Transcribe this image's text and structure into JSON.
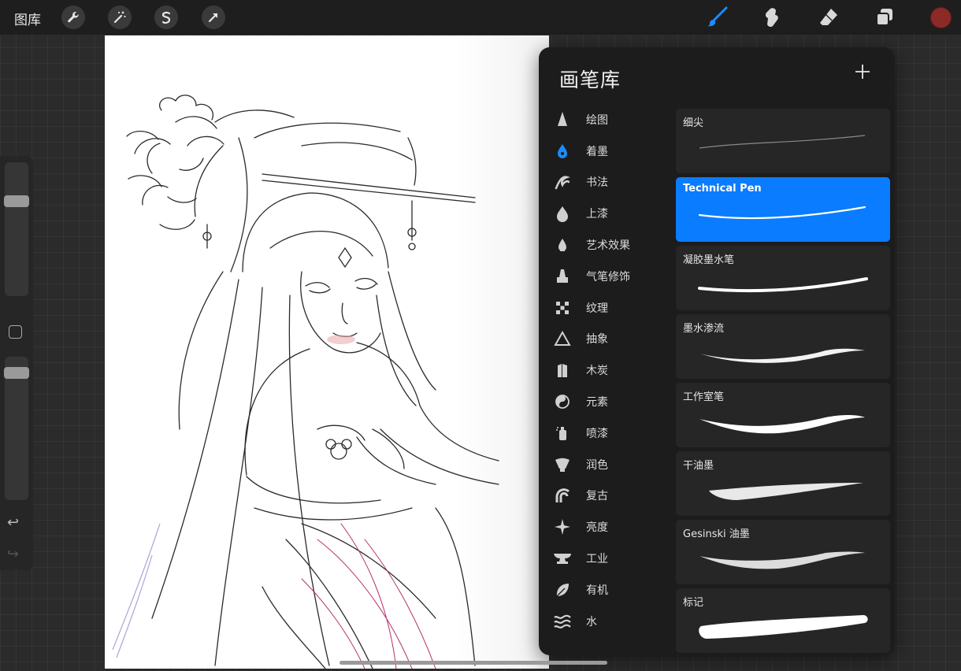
{
  "topbar": {
    "gallery_label": "图库",
    "left_tools": [
      "wrench-icon",
      "magic-wand-icon",
      "selection-icon",
      "transform-arrow-icon"
    ],
    "right_tools": [
      "brush-icon",
      "smudge-icon",
      "eraser-icon",
      "layers-icon"
    ],
    "active_tool": "brush",
    "accent_color": "#1a8cff",
    "current_color": "#8c2a28"
  },
  "sidebar": {
    "size_slider_level": 0.73,
    "opacity_slider_level": 0.92,
    "icons": [
      "modify-square-icon",
      "undo-icon",
      "redo-icon"
    ]
  },
  "brush_library": {
    "title": "画笔库",
    "add_icon": "plus-icon",
    "sets": [
      {
        "label": "绘图",
        "icon": "pencil-tip-icon"
      },
      {
        "label": "着墨",
        "icon": "ink-pen-icon",
        "active": true
      },
      {
        "label": "书法",
        "icon": "calligraphy-icon"
      },
      {
        "label": "上漆",
        "icon": "paint-drop-icon"
      },
      {
        "label": "艺术效果",
        "icon": "artistic-drop-icon"
      },
      {
        "label": "气笔修饰",
        "icon": "airbrush-icon"
      },
      {
        "label": "纹理",
        "icon": "texture-checker-icon"
      },
      {
        "label": "抽象",
        "icon": "triangle-icon"
      },
      {
        "label": "木炭",
        "icon": "charcoal-icon"
      },
      {
        "label": "元素",
        "icon": "yin-yang-icon"
      },
      {
        "label": "喷漆",
        "icon": "spray-can-icon"
      },
      {
        "label": "润色",
        "icon": "fan-brush-icon"
      },
      {
        "label": "复古",
        "icon": "vintage-arch-icon"
      },
      {
        "label": "亮度",
        "icon": "sparkle-icon"
      },
      {
        "label": "工业",
        "icon": "anvil-icon"
      },
      {
        "label": "有机",
        "icon": "leaf-icon"
      },
      {
        "label": "水",
        "icon": "waves-icon"
      }
    ],
    "brushes": [
      {
        "name": "细尖"
      },
      {
        "name": "Technical Pen",
        "selected": true
      },
      {
        "name": "凝胶墨水笔"
      },
      {
        "name": "墨水渗流"
      },
      {
        "name": "工作室笔"
      },
      {
        "name": "干油墨"
      },
      {
        "name": "Gesinski 油墨"
      },
      {
        "name": "标记"
      }
    ],
    "selected_color": "#0a7cff"
  }
}
